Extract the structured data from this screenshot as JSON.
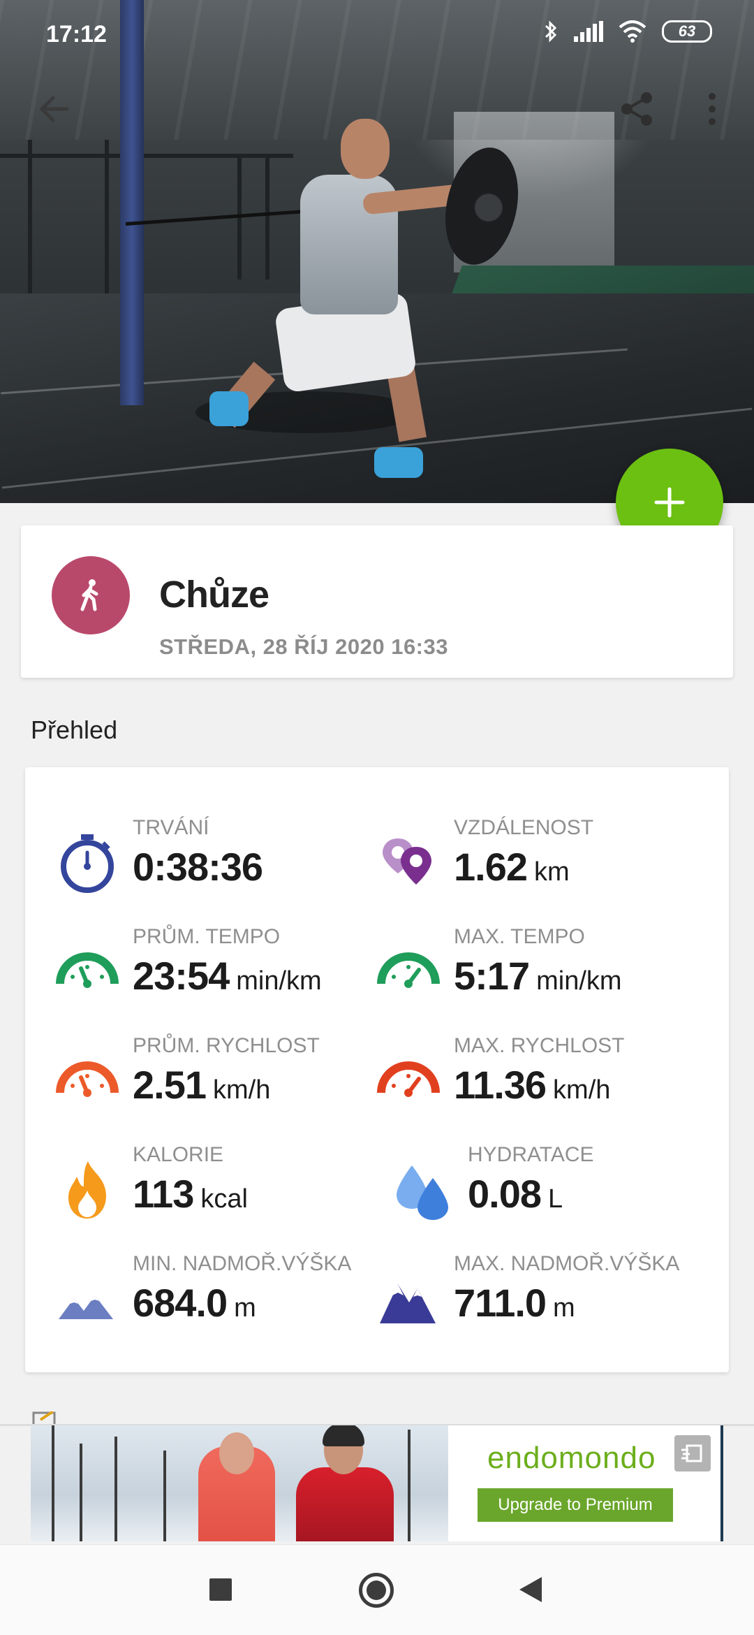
{
  "status_bar": {
    "time": "17:12",
    "battery": "63"
  },
  "activity": {
    "title": "Chůze",
    "date": "STŘEDA, 28 ŘÍJ 2020 16:33",
    "icon": "walking-person-icon",
    "color": "#b9496b"
  },
  "section_title": "Přehled",
  "stats": [
    {
      "label": "TRVÁNÍ",
      "value": "0:38:36",
      "unit": "",
      "icon": "stopwatch-icon"
    },
    {
      "label": "VZDÁLENOST",
      "value": "1.62",
      "unit": "km",
      "icon": "map-pins-icon"
    },
    {
      "label": "PRŮM. TEMPO",
      "value": "23:54",
      "unit": "min/km",
      "icon": "green-speedometer-icon"
    },
    {
      "label": "MAX. TEMPO",
      "value": "5:17",
      "unit": "min/km",
      "icon": "green-speedometer-max-icon"
    },
    {
      "label": "PRŮM. RYCHLOST",
      "value": "2.51",
      "unit": "km/h",
      "icon": "orange-speedometer-icon"
    },
    {
      "label": "MAX. RYCHLOST",
      "value": "11.36",
      "unit": "km/h",
      "icon": "red-speedometer-max-icon"
    },
    {
      "label": "KALORIE",
      "value": "113",
      "unit": "kcal",
      "icon": "flame-icon"
    },
    {
      "label": "HYDRATACE",
      "value": "0.08",
      "unit": "L",
      "icon": "water-drops-icon"
    },
    {
      "label": "MIN. NADMOŘ.VÝŠKA",
      "value": "684.0",
      "unit": "m",
      "icon": "low-mountain-icon"
    },
    {
      "label": "MAX. NADMOŘ.VÝŠKA",
      "value": "711.0",
      "unit": "m",
      "icon": "high-mountain-icon"
    }
  ],
  "ad": {
    "brand": "endomondo",
    "cta": "Upgrade to Premium"
  },
  "colors": {
    "fab": "#6cc011",
    "accent_green": "#6aa62b"
  }
}
